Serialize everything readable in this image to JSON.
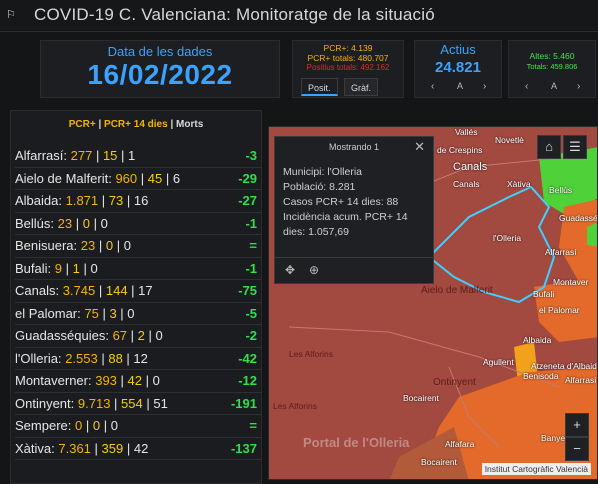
{
  "header": {
    "title": "COVID-19 C. Valenciana: Monitoratge de la situació",
    "logo_icon": "app-logo-icon"
  },
  "date_card": {
    "label": "Data de les dades",
    "value": "16/02/2022"
  },
  "totals_card": {
    "pcr": "PCR+: 4.139",
    "pcr_totals": "PCR+ totals: 480.707",
    "positius_totals": "Positius totals: 492.162",
    "tab_posit": "Posit.",
    "tab_graf": "Gràf."
  },
  "actius_card": {
    "label": "Actius",
    "value": "24.821"
  },
  "altes_card": {
    "altes": "Altes: 5.460",
    "totals": "Totals: 459.806"
  },
  "pager": {
    "left": "‹",
    "mid": "A",
    "right": "›"
  },
  "list": {
    "header_pcr": "PCR+",
    "header_sep1": " | ",
    "header_pcr14": "PCR+ 14 dies",
    "header_sep2": " | ",
    "header_morts": "Morts",
    "rows": [
      {
        "muni": "Alfarrasí:",
        "pcr": "277",
        "pcr14": "15",
        "morts": "1",
        "delta": "-3"
      },
      {
        "muni": "Aielo de Malferit:",
        "pcr": "960",
        "pcr14": "45",
        "morts": "6",
        "delta": "-29"
      },
      {
        "muni": "Albaida:",
        "pcr": "1.871",
        "pcr14": "73",
        "morts": "16",
        "delta": "-27"
      },
      {
        "muni": "Bellús:",
        "pcr": "23",
        "pcr14": "0",
        "morts": "0",
        "delta": "-1"
      },
      {
        "muni": "Benisuera:",
        "pcr": "23",
        "pcr14": "0",
        "morts": "0",
        "delta": "="
      },
      {
        "muni": "Bufali:",
        "pcr": "9",
        "pcr14": "1",
        "morts": "0",
        "delta": "-1"
      },
      {
        "muni": "Canals:",
        "pcr": "3.745",
        "pcr14": "144",
        "morts": "17",
        "delta": "-75"
      },
      {
        "muni": "el Palomar:",
        "pcr": "75",
        "pcr14": "3",
        "morts": "0",
        "delta": "-5"
      },
      {
        "muni": "Guadasséquies:",
        "pcr": "67",
        "pcr14": "2",
        "morts": "0",
        "delta": "-2"
      },
      {
        "muni": "l'Olleria:",
        "pcr": "2.553",
        "pcr14": "88",
        "morts": "12",
        "delta": "-42"
      },
      {
        "muni": "Montaverner:",
        "pcr": "393",
        "pcr14": "42",
        "morts": "0",
        "delta": "-12"
      },
      {
        "muni": "Ontinyent:",
        "pcr": "9.713",
        "pcr14": "554",
        "morts": "51",
        "delta": "-191"
      },
      {
        "muni": "Sempere:",
        "pcr": "0",
        "pcr14": "0",
        "morts": "0",
        "delta": "="
      },
      {
        "muni": "Xàtiva:",
        "pcr": "7.361",
        "pcr14": "359",
        "morts": "42",
        "delta": "-137"
      }
    ]
  },
  "popup": {
    "title": "Mostrando 1",
    "line1": "Municipi: l'Olleria",
    "line2": "Població: 8.281",
    "line3": "Casos PCR+ 14 dies: 88",
    "line4": "Incidència acum. PCR+ 14",
    "line5": "dies: 1.057,69"
  },
  "map": {
    "labels": {
      "valles": "Vallés",
      "novetle": "Novetlè",
      "crespins": "de Crespins",
      "canals_top": "Canals",
      "canals": "Canals",
      "xativa": "Xàtiva",
      "bellus": "Bellús",
      "guadasequies": "Guadasséquies",
      "lolleria": "l'Olleria",
      "alfarrasi": "Alfarrasí",
      "aielo": "Aielo de Malferit",
      "montaverner": "Montaver",
      "bufali": "Bufali",
      "palomar": "el Palomar",
      "albaida": "Albaida",
      "agullent": "Agullent",
      "benisoda": "Benisoda",
      "atzeneta": "Atzeneta d'Albaida",
      "alfarrasi2": "Alfarrasi",
      "alforins": "Les Alforins",
      "ontinyent": "Ontinyent",
      "alforins2": "Les Alforins",
      "bocairent": "Bocairent",
      "alfafara": "Alfafara",
      "banyeres": "Banyeres",
      "bocairent2": "Bocairent"
    },
    "watermark": "Portal de l'Olleria",
    "attribution": "Institut Cartogràfic Valencià",
    "zoom_in": "+",
    "zoom_out": "−"
  },
  "colors": {
    "accent": "#3aa3ff",
    "amber": "#f5b400",
    "green": "#2ee04a",
    "red": "#d62b2b",
    "map_dark": "#a24940",
    "map_orange": "#e36a2b",
    "boundary": "#3fd0ff"
  }
}
